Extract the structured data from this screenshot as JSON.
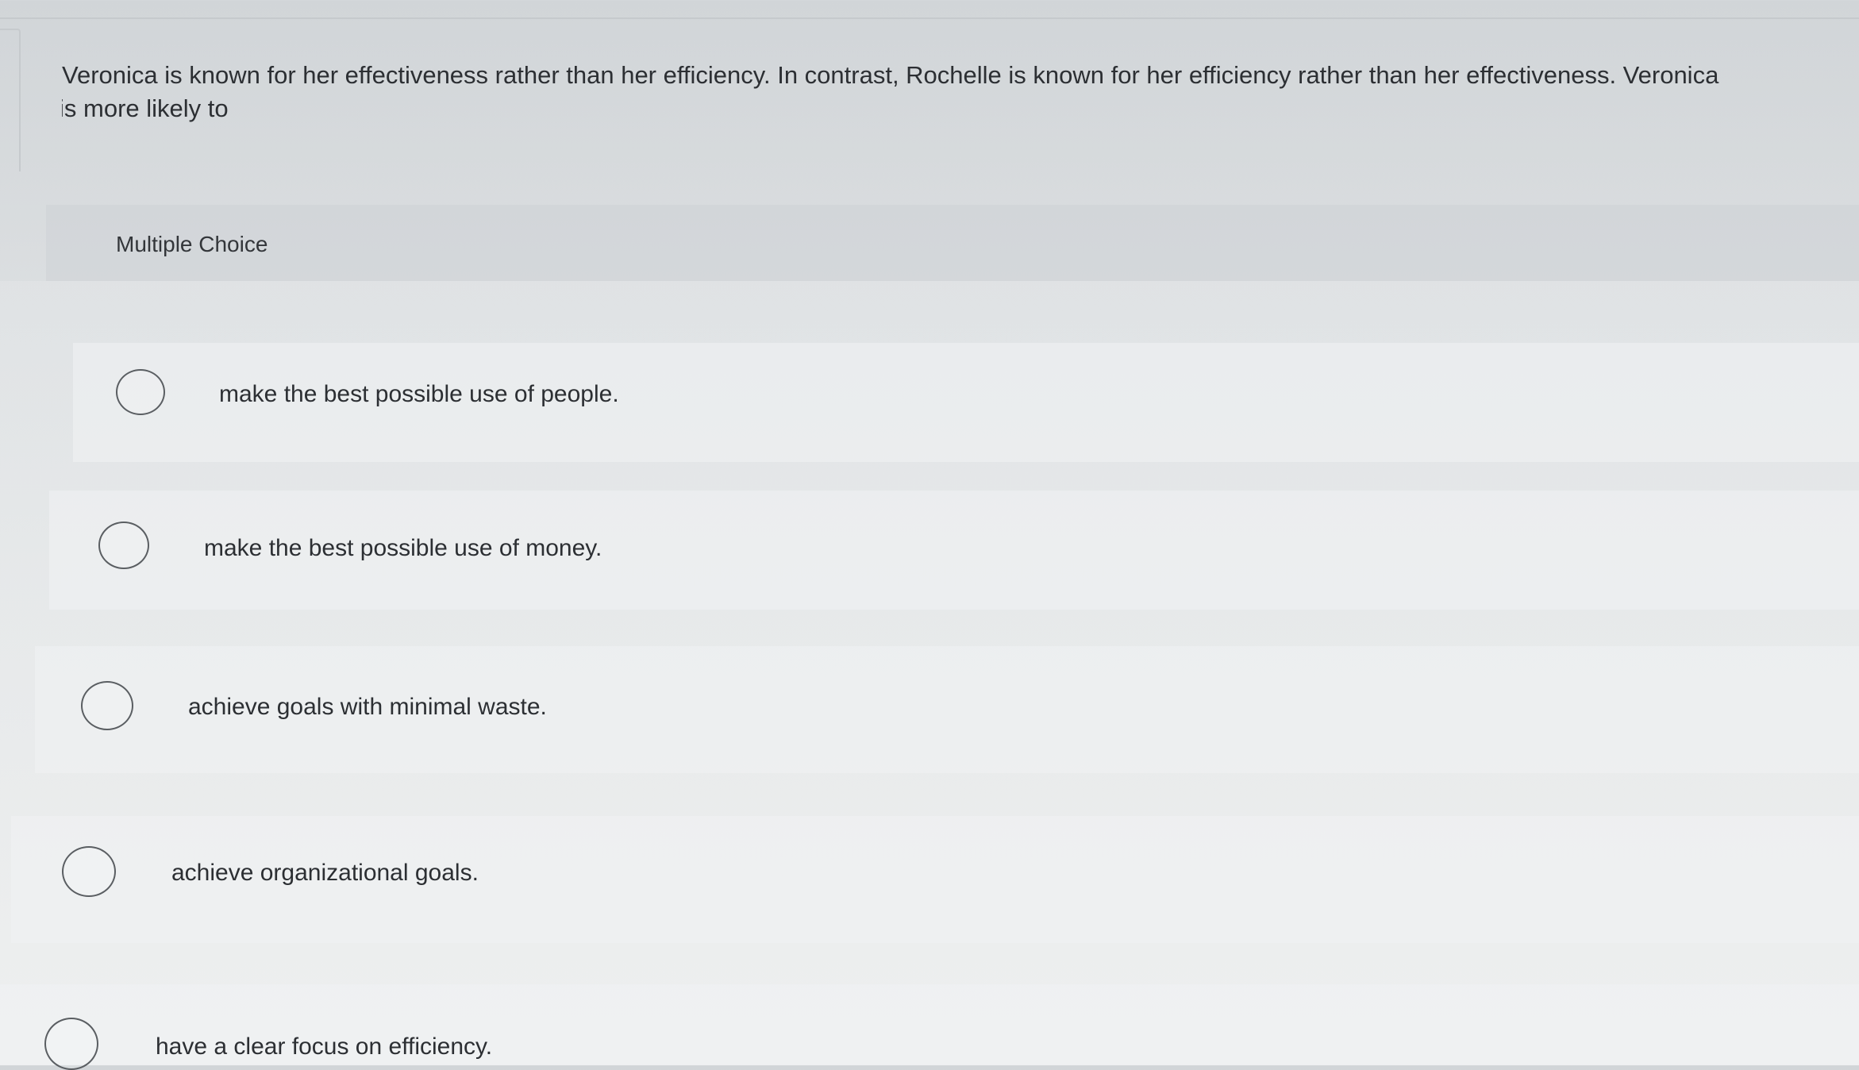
{
  "question": {
    "line1": "Veronica is known for her effectiveness rather than her efficiency. In contrast, Rochelle is known for her efficiency rather than her effectiveness.  Veronica",
    "line2": "is more likely to"
  },
  "section": {
    "label": "Multiple Choice"
  },
  "options": [
    {
      "text": "make the best possible use of people."
    },
    {
      "text": "make the best possible use of money."
    },
    {
      "text": "achieve goals with minimal waste."
    },
    {
      "text": "achieve organizational goals."
    },
    {
      "text": "have a clear focus on efficiency."
    }
  ]
}
